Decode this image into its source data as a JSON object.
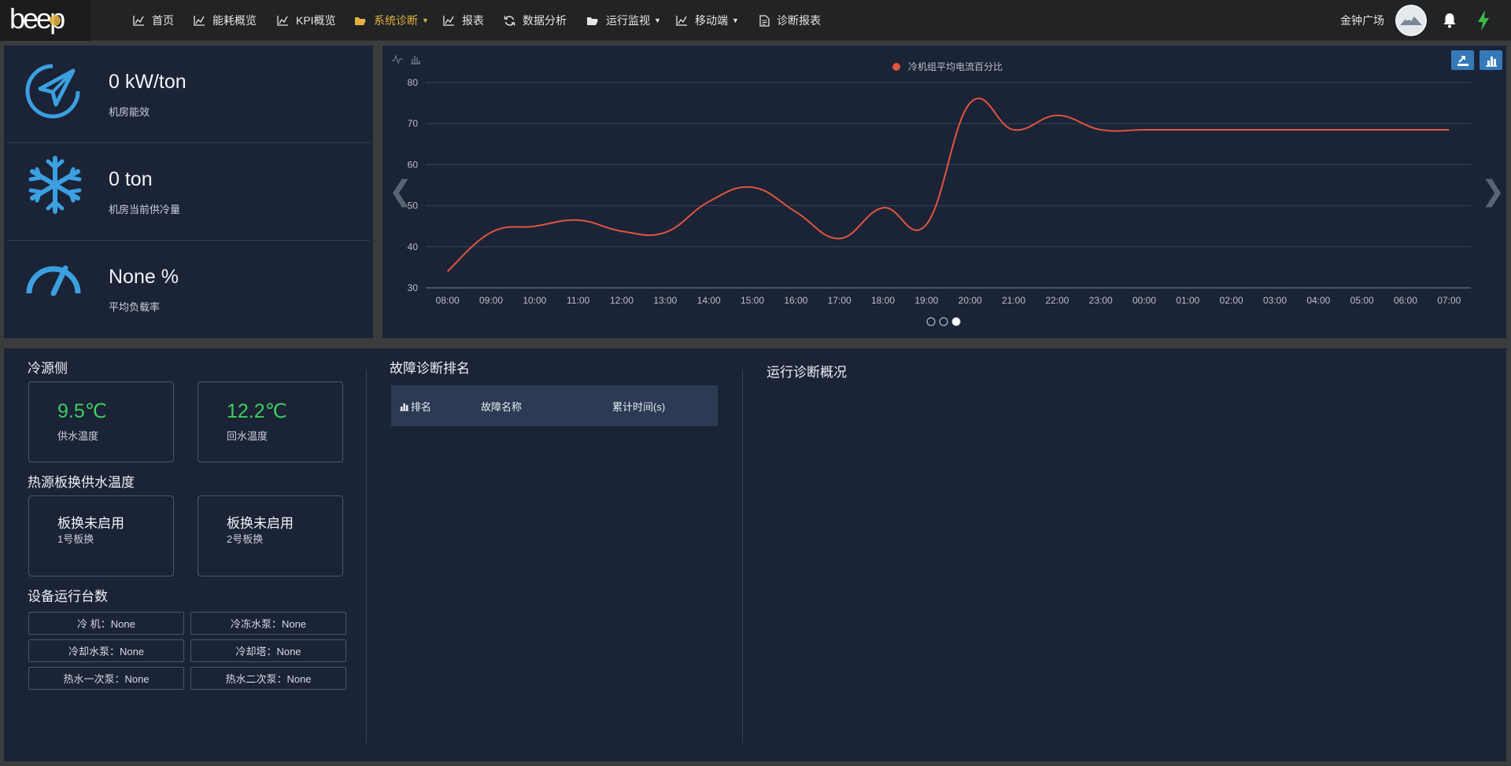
{
  "nav": {
    "logo_text": "beep",
    "items": [
      {
        "label": "首页",
        "icon": "line-chart-icon"
      },
      {
        "label": "能耗概览",
        "icon": "line-chart-icon"
      },
      {
        "label": "KPI概览",
        "icon": "line-chart-icon"
      },
      {
        "label": "系统诊断",
        "icon": "folder-open-icon",
        "active": true,
        "dropdown": true
      },
      {
        "label": "报表",
        "icon": "line-chart-icon"
      },
      {
        "label": "数据分析",
        "icon": "refresh-icon"
      },
      {
        "label": "运行监视",
        "icon": "folder-open-icon",
        "dropdown": true
      },
      {
        "label": "移动端",
        "icon": "line-chart-icon",
        "dropdown": true
      },
      {
        "label": "诊断报表",
        "icon": "document-icon"
      }
    ],
    "site_name": "金钟广场",
    "active_color": "#e3b341"
  },
  "kpis": [
    {
      "value": "0 kW/ton",
      "label": "机房能效",
      "icon": "paper-plane-icon"
    },
    {
      "value": "0 ton",
      "label": "机房当前供冷量",
      "icon": "snowflake-icon"
    },
    {
      "value": "None %",
      "label": "平均负载率",
      "icon": "gauge-icon"
    }
  ],
  "chart_data": {
    "type": "line",
    "legend": "冷机组平均电流百分比",
    "legend_position": "top-center",
    "series_color": "#e0553d",
    "categories": [
      "08:00",
      "09:00",
      "10:00",
      "11:00",
      "12:00",
      "13:00",
      "14:00",
      "15:00",
      "16:00",
      "17:00",
      "18:00",
      "19:00",
      "20:00",
      "21:00",
      "22:00",
      "23:00",
      "00:00",
      "01:00",
      "02:00",
      "03:00",
      "04:00",
      "05:00",
      "06:00",
      "07:00"
    ],
    "values": [
      34,
      43.5,
      45,
      46.5,
      43.8,
      43.5,
      51,
      54.5,
      48.5,
      42,
      49.5,
      45.5,
      75,
      68.5,
      72,
      68.5,
      68.5,
      68.5,
      68.5,
      68.5,
      68.5,
      68.5,
      68.5,
      68.5
    ],
    "ylim": [
      30,
      80
    ],
    "yticks": [
      30,
      40,
      50,
      60,
      70,
      80
    ],
    "grid": true,
    "pager": {
      "count": 3,
      "active": 3
    }
  },
  "cold_source": {
    "title": "冷源侧",
    "supply": {
      "value": "9.5℃",
      "label": "供水温度"
    },
    "return": {
      "value": "12.2℃",
      "label": "回水温度"
    },
    "value_color": "#3ccf5e"
  },
  "heat_source": {
    "title": "热源板换供水温度",
    "hx1": {
      "value": "板换未启用",
      "label": "1号板换"
    },
    "hx2": {
      "value": "板换未启用",
      "label": "2号板换"
    }
  },
  "devices": {
    "title": "设备运行台数",
    "items": [
      "冷 机：None",
      "冷冻水泵：None",
      "冷却水泵：None",
      "冷却塔：None",
      "热水一次泵：None",
      "热水二次泵：None"
    ]
  },
  "fault_ranking": {
    "title": "故障诊断排名",
    "columns": [
      "排名",
      "故障名称",
      "累计时间(s)"
    ],
    "rows": []
  },
  "overview": {
    "title": "运行诊断概况"
  }
}
